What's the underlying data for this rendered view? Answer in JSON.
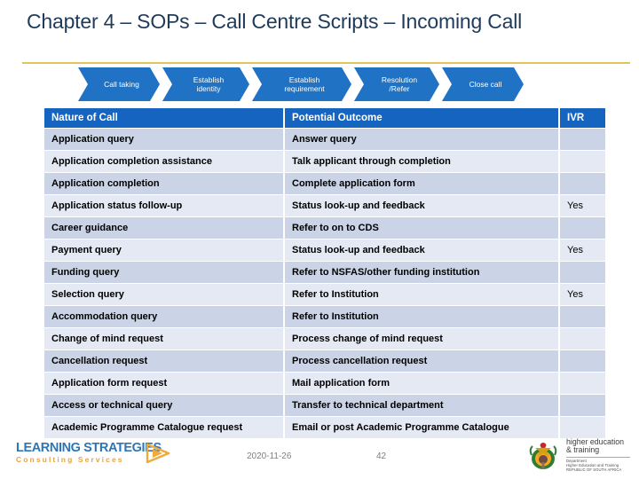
{
  "title": "Chapter 4 – SOPs – Call Centre Scripts – Incoming Call",
  "colors": {
    "title_navy": "#1F3A5A",
    "gold_rule": "#E3C45A",
    "chevron_blue": "#1F72C4",
    "header_blue": "#1565C0",
    "row_odd": "#CBD4E6",
    "row_even": "#E4E9F4",
    "logo_blue": "#2E75B6",
    "logo_orange": "#E8A33D"
  },
  "process_flow": {
    "steps": [
      {
        "label": "Call taking"
      },
      {
        "label": "Establish\nidentity"
      },
      {
        "label": "Establish\nrequirement"
      },
      {
        "label": "Resolution\n/Refer"
      },
      {
        "label": "Close call"
      }
    ]
  },
  "table": {
    "headers": [
      "Nature of Call",
      "Potential Outcome",
      "IVR"
    ],
    "rows": [
      {
        "nature": "Application query",
        "outcome": "Answer query",
        "ivr": ""
      },
      {
        "nature": "Application completion assistance",
        "outcome": "Talk applicant through completion",
        "ivr": ""
      },
      {
        "nature": "Application completion",
        "outcome": "Complete application form",
        "ivr": ""
      },
      {
        "nature": "Application status follow-up",
        "outcome": "Status look-up and feedback",
        "ivr": "Yes"
      },
      {
        "nature": "Career guidance",
        "outcome": "Refer to on to CDS",
        "ivr": ""
      },
      {
        "nature": "Payment query",
        "outcome": "Status look-up and feedback",
        "ivr": "Yes"
      },
      {
        "nature": "Funding query",
        "outcome": "Refer to NSFAS/other funding institution",
        "ivr": ""
      },
      {
        "nature": "Selection query",
        "outcome": "Refer to Institution",
        "ivr": "Yes"
      },
      {
        "nature": "Accommodation query",
        "outcome": "Refer to Institution",
        "ivr": ""
      },
      {
        "nature": "Change of mind request",
        "outcome": "Process change of mind request",
        "ivr": ""
      },
      {
        "nature": "Cancellation request",
        "outcome": "Process cancellation request",
        "ivr": ""
      },
      {
        "nature": "Application form request",
        "outcome": "Mail application form",
        "ivr": ""
      },
      {
        "nature": "Access or technical query",
        "outcome": "Transfer to technical department",
        "ivr": ""
      },
      {
        "nature": "Academic Programme Catalogue request",
        "outcome": "Email or post Academic Programme Catalogue",
        "ivr": ""
      }
    ]
  },
  "footer": {
    "date": "2020-11-26",
    "page_number": "42",
    "left_logo": {
      "name": "LEARNING STRATEGIES",
      "tagline": "Consulting Services",
      "mark": "triangle-play-icon"
    },
    "right_logo": {
      "main": "higher education\n& training",
      "line1": "Department",
      "line2": "Higher Education and Training",
      "line3": "REPUBLIC OF SOUTH AFRICA",
      "emblem": "south-africa-coat-of-arms-icon"
    }
  }
}
